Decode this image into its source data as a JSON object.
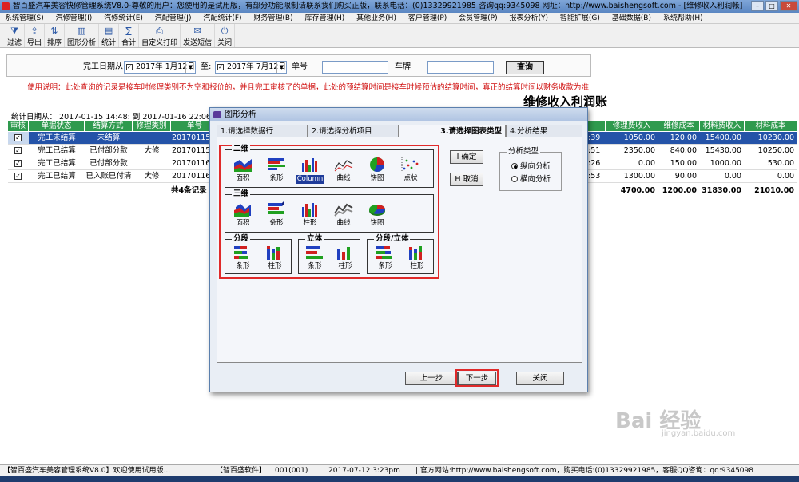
{
  "window": {
    "title": "智百盛汽车美容快修管理系统V8.0-尊敬的用户：您使用的是试用版，有部分功能限制请联系我们购买正版，联系电话：(0)13329921985  咨询qq:9345098   网址：http://www.baishengsoft.com - [维修收入利润帐]"
  },
  "menu": [
    "系统管理(S)",
    "汽修管理(I)",
    "汽修统计(E)",
    "汽配管理(J)",
    "汽配统计(F)",
    "财务管理(B)",
    "库存管理(H)",
    "其他业务(H)",
    "客户管理(P)",
    "会员管理(P)",
    "报表分析(Y)",
    "智能扩展(G)",
    "基础数据(B)",
    "系统帮助(H)"
  ],
  "toolbar": [
    "过滤",
    "导出",
    "排序",
    "图形分析",
    "统计",
    "合计",
    "自定义打印",
    "发送短信",
    "关闭"
  ],
  "filter": {
    "date_label": "完工日期从:",
    "date_from": "2017年 1月12日",
    "to_label": "至:",
    "date_to": "2017年 7月12日",
    "doc_label": "单号",
    "plate_label": "车牌",
    "query_btn": "查询"
  },
  "notice": "使用说明：此处查询的记录是接车时修理类别不为空和报价的，并且完工审核了的单据，此处的预结算时间是接车时候预估的结算时间，真正的结算时间以财务收款为准",
  "report_title": "维修收入利润账",
  "stat_text": "统计日期从：  2017-01-15 14:48: 到  2017-01-16 22:06:",
  "grid": {
    "headers_left": [
      "审核",
      "单据状态",
      "结算方式",
      "修理类别",
      "单号"
    ],
    "headers_right": [
      "修理费收入",
      "维修成本",
      "材料费收入",
      "材料成本"
    ],
    "rows": [
      {
        "status": "完工未结算",
        "pay": "未结算",
        "type": "",
        "no": "201701151",
        "time": ":39",
        "repair": "1050.00",
        "rcost": "120.00",
        "mat": "15400.00",
        "mcost": "10230.00"
      },
      {
        "status": "完工已结算",
        "pay": "已付部分款",
        "type": "大修",
        "no": "201701151",
        "time": ":51",
        "repair": "2350.00",
        "rcost": "840.00",
        "mat": "15430.00",
        "mcost": "10250.00"
      },
      {
        "status": "完工已结算",
        "pay": "已付部分款",
        "type": "",
        "no": "201701161",
        "time": ":26",
        "repair": "0.00",
        "rcost": "150.00",
        "mat": "1000.00",
        "mcost": "530.00"
      },
      {
        "status": "完工已结算",
        "pay": "已入账已付清",
        "type": "大修",
        "no": "201701162",
        "time": ":53",
        "repair": "1300.00",
        "rcost": "90.00",
        "mat": "0.00",
        "mcost": "0.00"
      }
    ],
    "total_label": "共4条记录",
    "totals": {
      "repair": "4700.00",
      "rcost": "1200.00",
      "mat": "31830.00",
      "mcost": "21010.00"
    }
  },
  "dialog": {
    "title": "图形分析",
    "tabs": [
      "1.请选择数据行",
      "2.请选择分析项目",
      "3.请选择图表类型",
      "4.分析结果"
    ],
    "group_2d": "二维",
    "charts_2d": [
      "面积",
      "条形",
      "Column",
      "曲线",
      "饼图",
      "点状"
    ],
    "group_3d": "三维",
    "charts_3d": [
      "面积",
      "条形",
      "柱形",
      "曲线",
      "饼图"
    ],
    "group_seg": "分段",
    "group_solid": "立体",
    "group_segsolid": "分段/立体",
    "charts_small": [
      "条形",
      "柱形"
    ],
    "ok_btn": "确定",
    "ok_key": "I",
    "cancel_btn": "取消",
    "cancel_key": "H",
    "analysis_type_label": "分析类型",
    "radio_vertical": "纵向分析",
    "radio_horizontal": "横向分析",
    "prev_btn": "上一步",
    "next_btn": "下一步",
    "close_btn": "关闭"
  },
  "statusbar": {
    "s1": "【智百盛汽车美容管理系统V8.0】欢迎使用试用版...",
    "s2": "【智百盛软件】",
    "s3": "001(001)",
    "s4": "2017-07-12 3:23pm",
    "s5": "| 官方网站:http://www.baishengsoft.com，购买电话:(0)13329921985，客服QQ咨询：qq:9345098"
  },
  "watermark": {
    "brand": "Bai 经验",
    "url": "jingyan.baidu.com"
  }
}
